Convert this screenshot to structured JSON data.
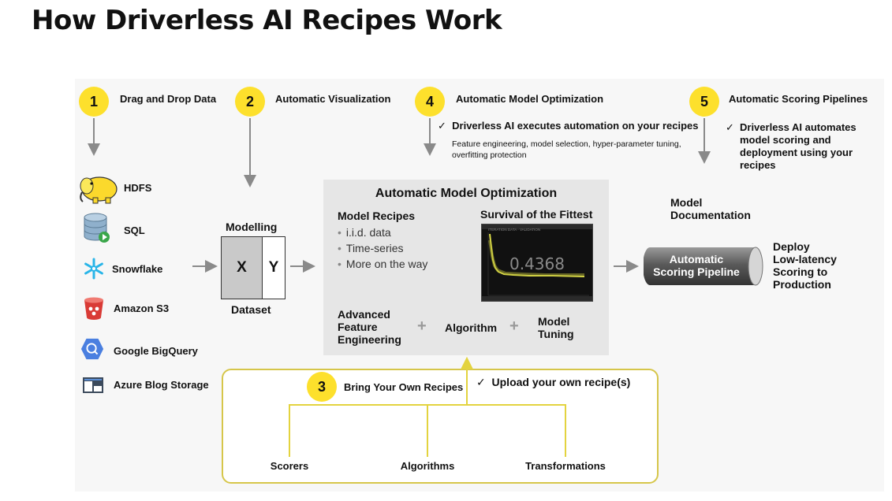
{
  "title": "How Driverless AI Recipes Work",
  "steps": [
    {
      "num": "1",
      "label": "Drag and Drop Data"
    },
    {
      "num": "2",
      "label": "Automatic Visualization"
    },
    {
      "num": "3",
      "label": "Bring Your Own Recipes"
    },
    {
      "num": "4",
      "label": "Automatic Model Optimization"
    },
    {
      "num": "5",
      "label": "Automatic Scoring Pipelines"
    }
  ],
  "step4": {
    "check_text": "Driverless AI executes automation on your recipes",
    "detail_line1": "Feature engineering, model selection, hyper-parameter tuning,",
    "detail_line2": "overfitting protection"
  },
  "step5": {
    "check_lines": [
      "Driverless AI automates",
      "model scoring and",
      "deployment using your",
      "recipes"
    ]
  },
  "sources": [
    {
      "label": "HDFS",
      "icon": "hdfs-elephant-icon"
    },
    {
      "label": "SQL",
      "icon": "sql-database-icon"
    },
    {
      "label": "Snowflake",
      "icon": "snowflake-icon"
    },
    {
      "label": "Amazon S3",
      "icon": "amazon-s3-bucket-icon"
    },
    {
      "label": "Google BigQuery",
      "icon": "google-bigquery-icon"
    },
    {
      "label": "Azure Blog Storage",
      "icon": "azure-storage-icon"
    }
  ],
  "dataset": {
    "top_label": "Modelling",
    "x": "X",
    "y": "Y",
    "bottom_label": "Dataset"
  },
  "optimization": {
    "title": "Automatic Model Optimization",
    "recipes_heading": "Model Recipes",
    "recipes": [
      "i.i.d. data",
      "Time-series",
      "More on the way"
    ],
    "survival_heading": "Survival of the Fittest",
    "chart_caption": "ITERATION DATA - VALIDATION",
    "chart_value": "0.4368",
    "feature_engineering": [
      "Advanced",
      "Feature",
      "Engineering"
    ],
    "plus": "+",
    "algorithm": "Algorithm",
    "model_tuning": [
      "Model",
      "Tuning"
    ]
  },
  "documentation": [
    "Model",
    "Documentation"
  ],
  "pipeline": {
    "lines": [
      "Automatic",
      "Scoring Pipeline"
    ]
  },
  "deploy": [
    "Deploy",
    "Low-latency",
    "Scoring to",
    "Production"
  ],
  "byo": {
    "check_text": "Upload your own recipe(s)",
    "items": [
      "Scorers",
      "Algorithms",
      "Transformations"
    ]
  },
  "check_mark": "✓",
  "colors": {
    "badge": "#fde02c",
    "byo_border": "#d6c64a",
    "chart_line": "#e1e14a",
    "panel": "#f7f7f7",
    "opt_box": "#e6e6e6"
  }
}
